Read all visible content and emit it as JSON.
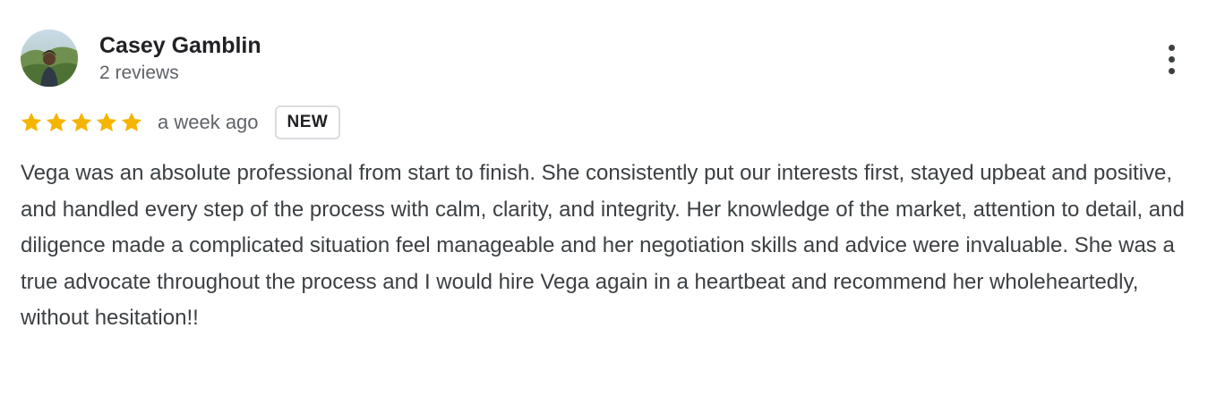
{
  "reviewer": {
    "name": "Casey Gamblin",
    "review_count": "2 reviews",
    "avatar": "avatar-photo"
  },
  "more_menu_icon": "more-vert-icon",
  "rating": {
    "stars_filled": 5,
    "stars_total": 5,
    "star_color": "#f4b400",
    "date": "a week ago",
    "badge": "NEW"
  },
  "review": {
    "text": "Vega was an absolute professional from start to finish. She consistently put our interests first, stayed upbeat and positive, and handled every step of the process with calm, clarity, and integrity. Her knowledge of the market, attention to detail, and diligence made a complicated situation feel manageable and her negotiation skills and advice were invaluable. She was a true advocate throughout the process and I would hire Vega again in a heartbeat and recommend her wholeheartedly, without hesitation!!"
  }
}
